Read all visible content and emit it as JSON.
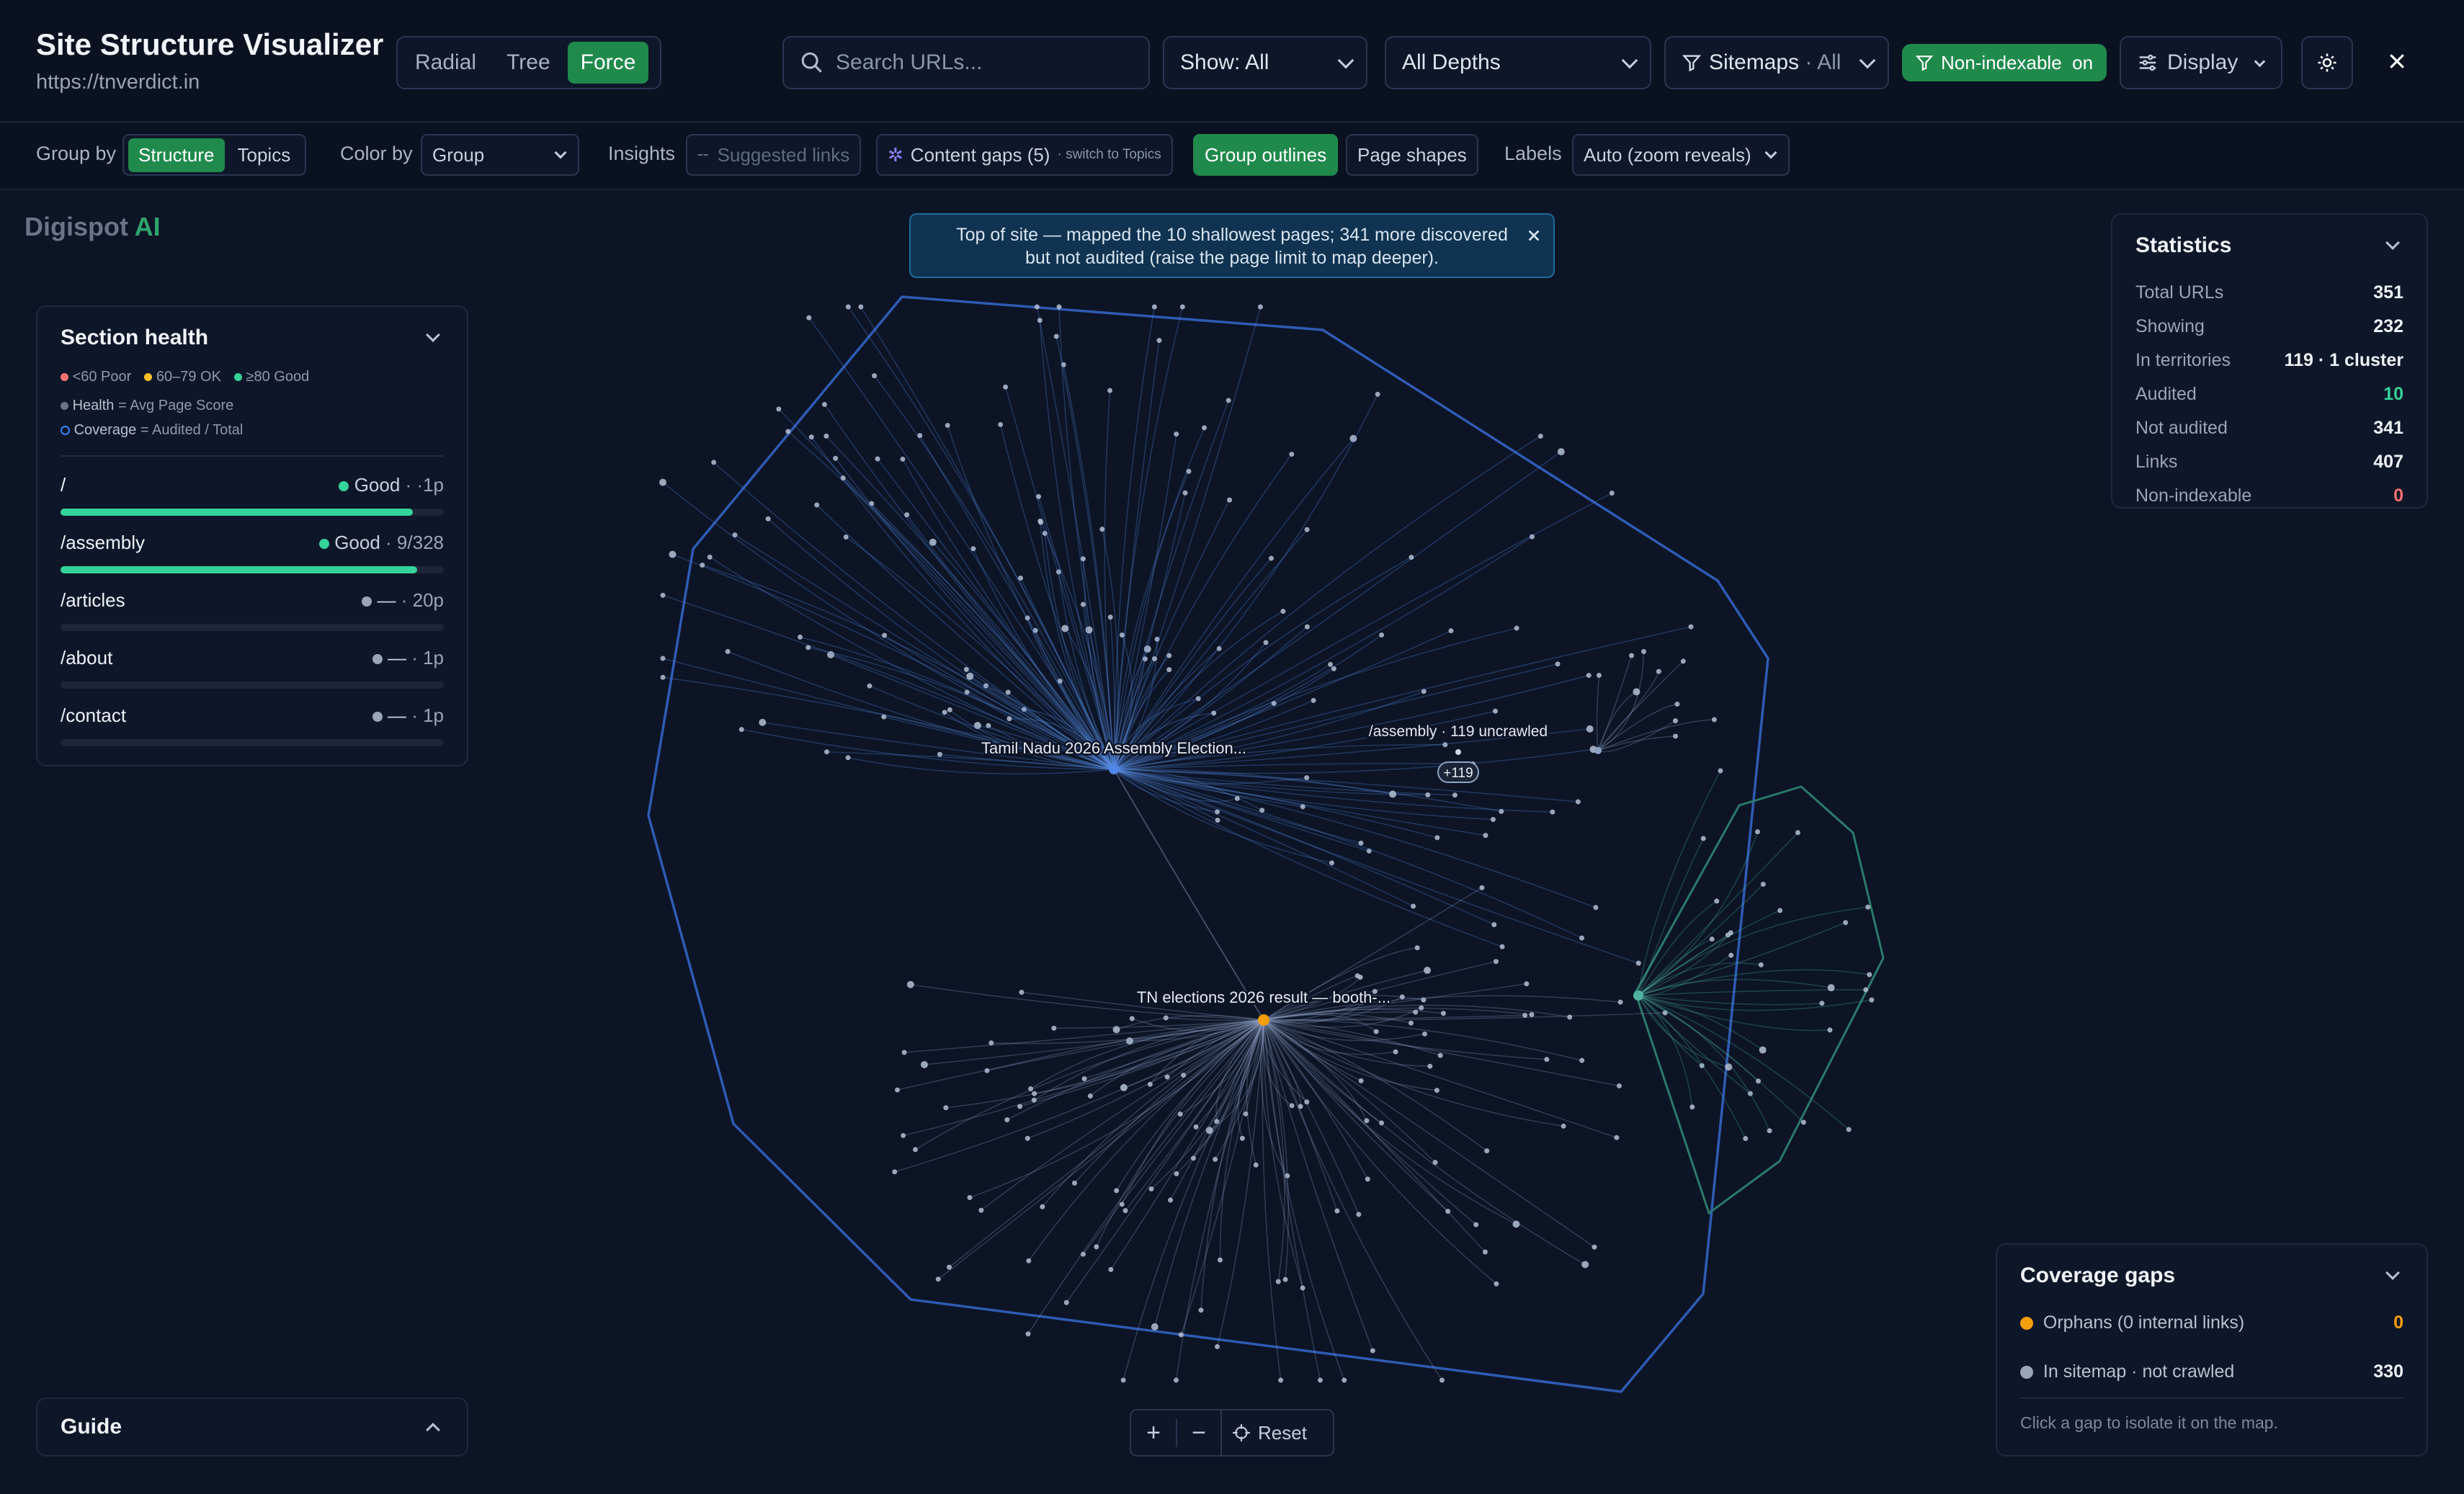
{
  "header": {
    "title": "Site Structure Visualizer",
    "url": "https://tnverdict.in",
    "views": [
      "Radial",
      "Tree",
      "Force"
    ],
    "active_view": "Force",
    "search_placeholder": "Search URLs...",
    "show_value": "Show: All",
    "depth_value": "All Depths",
    "sitemaps_label": "Sitemaps",
    "sitemaps_value": "· All",
    "nonindexable_label": "Non-indexable",
    "nonindexable_state": "on",
    "display_label": "Display"
  },
  "toolbar": {
    "group_by_label": "Group by",
    "group_options": [
      "Structure",
      "Topics"
    ],
    "group_active": "Structure",
    "color_by_label": "Color by",
    "color_value": "Group",
    "insights_label": "Insights",
    "suggested_links": "Suggested links",
    "content_gaps": "Content gaps (5)",
    "content_gaps_hint": "· switch to Topics",
    "group_outlines": "Group outlines",
    "page_shapes": "Page shapes",
    "labels_label": "Labels",
    "labels_value": "Auto (zoom reveals)"
  },
  "brand": {
    "name": "Digispot",
    "suffix": "AI"
  },
  "notice": {
    "line1": "Top of site — mapped the 10 shallowest pages; 341 more discovered",
    "line2": "but not audited (raise the page limit to map deeper)."
  },
  "section_health": {
    "title": "Section health",
    "legend": [
      "<60 Poor",
      "60–79 OK",
      "≥80 Good"
    ],
    "legend_colors": [
      "#f87171",
      "#fbbf24",
      "#34d399"
    ],
    "health_note": "Health",
    "health_def": "= Avg Page Score",
    "coverage_note": "Coverage",
    "coverage_def": "= Audited / Total",
    "rows": [
      {
        "path": "/",
        "status": "Good",
        "meta": "·1p",
        "fill": 0.92,
        "color": "#34d399"
      },
      {
        "path": "/assembly",
        "status": "Good",
        "meta": "9/328",
        "fill": 0.93,
        "color": "#34d399"
      },
      {
        "path": "/articles",
        "status": "—",
        "meta": "20p",
        "fill": 0,
        "color": "#9aa5b8"
      },
      {
        "path": "/about",
        "status": "—",
        "meta": "1p",
        "fill": 0,
        "color": "#9aa5b8"
      },
      {
        "path": "/contact",
        "status": "—",
        "meta": "1p",
        "fill": 0,
        "color": "#9aa5b8"
      }
    ]
  },
  "guide": {
    "title": "Guide"
  },
  "statistics": {
    "title": "Statistics",
    "rows": [
      {
        "label": "Total URLs",
        "value": "351",
        "color": "#eef2f8"
      },
      {
        "label": "Showing",
        "value": "232",
        "color": "#eef2f8"
      },
      {
        "label": "In territories",
        "value": "119 · 1 cluster",
        "color": "#eef2f8"
      },
      {
        "label": "Audited",
        "value": "10",
        "color": "#34d399"
      },
      {
        "label": "Not audited",
        "value": "341",
        "color": "#eef2f8"
      },
      {
        "label": "Links",
        "value": "407",
        "color": "#eef2f8"
      },
      {
        "label": "Non-indexable",
        "value": "0",
        "color": "#f87171"
      }
    ]
  },
  "coverage": {
    "title": "Coverage gaps",
    "orphans_label": "Orphans (0 internal links)",
    "orphans_value": "0",
    "orphans_color": "#f59e0b",
    "sitemap_label": "In sitemap · not crawled",
    "sitemap_value": "330",
    "hint": "Click a gap to isolate it on the map."
  },
  "graph": {
    "label_home": "Tamil Nadu 2026 Assembly Election...",
    "label_result": "TN elections 2026 result — booth-...",
    "label_cluster": "/assembly · 119 uncrawled",
    "cluster_badge": "+119"
  },
  "zoom": {
    "plus": "+",
    "minus": "−",
    "reset": "Reset"
  }
}
